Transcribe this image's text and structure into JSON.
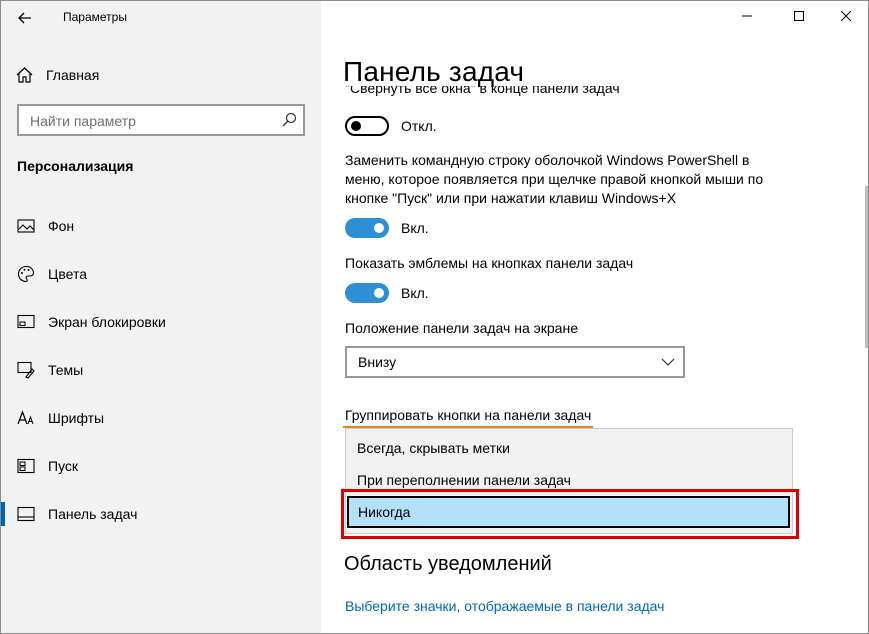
{
  "window": {
    "title": "Параметры",
    "minimize_icon": "minimize-icon",
    "maximize_icon": "maximize-icon",
    "close_icon": "close-icon"
  },
  "sidebar": {
    "home_label": "Главная",
    "search_placeholder": "Найти параметр",
    "section_title": "Персонализация",
    "items": [
      {
        "label": "Фон",
        "icon": "picture-icon",
        "active": false
      },
      {
        "label": "Цвета",
        "icon": "palette-icon",
        "active": false
      },
      {
        "label": "Экран блокировки",
        "icon": "lock-screen-icon",
        "active": false
      },
      {
        "label": "Темы",
        "icon": "themes-icon",
        "active": false
      },
      {
        "label": "Шрифты",
        "icon": "font-icon",
        "active": false
      },
      {
        "label": "Пуск",
        "icon": "start-icon",
        "active": false
      },
      {
        "label": "Панель задач",
        "icon": "taskbar-icon",
        "active": true
      }
    ]
  },
  "main": {
    "page_title": "Панель задач",
    "cut_text": "\"Свернуть все окна\" в конце панели задач",
    "toggle1_label": "Откл.",
    "powershell_text": "Заменить командную строку оболочкой Windows PowerShell в меню, которое появляется при щелчке правой кнопкой мыши по кнопке \"Пуск\" или при нажатии клавиш Windows+X",
    "toggle2_label": "Вкл.",
    "badges_text": "Показать эмблемы на кнопках панели задач",
    "toggle3_label": "Вкл.",
    "position_label": "Положение панели задач на экране",
    "position_value": "Внизу",
    "group_label": "Группировать кнопки на панели задач",
    "group_options": [
      "Всегда, скрывать метки",
      "При переполнении панели задач",
      "Никогда"
    ],
    "group_selected": "Никогда",
    "notification_title": "Область уведомлений",
    "notification_link": "Выберите значки, отображаемые в панели задач"
  },
  "colors": {
    "accent": "#0063b1",
    "toggle_on": "#2d8fd5",
    "selected_bg": "#b3e1fb",
    "highlight_red": "#e10000",
    "underline_orange": "#e8821e",
    "link": "#0067b8"
  }
}
